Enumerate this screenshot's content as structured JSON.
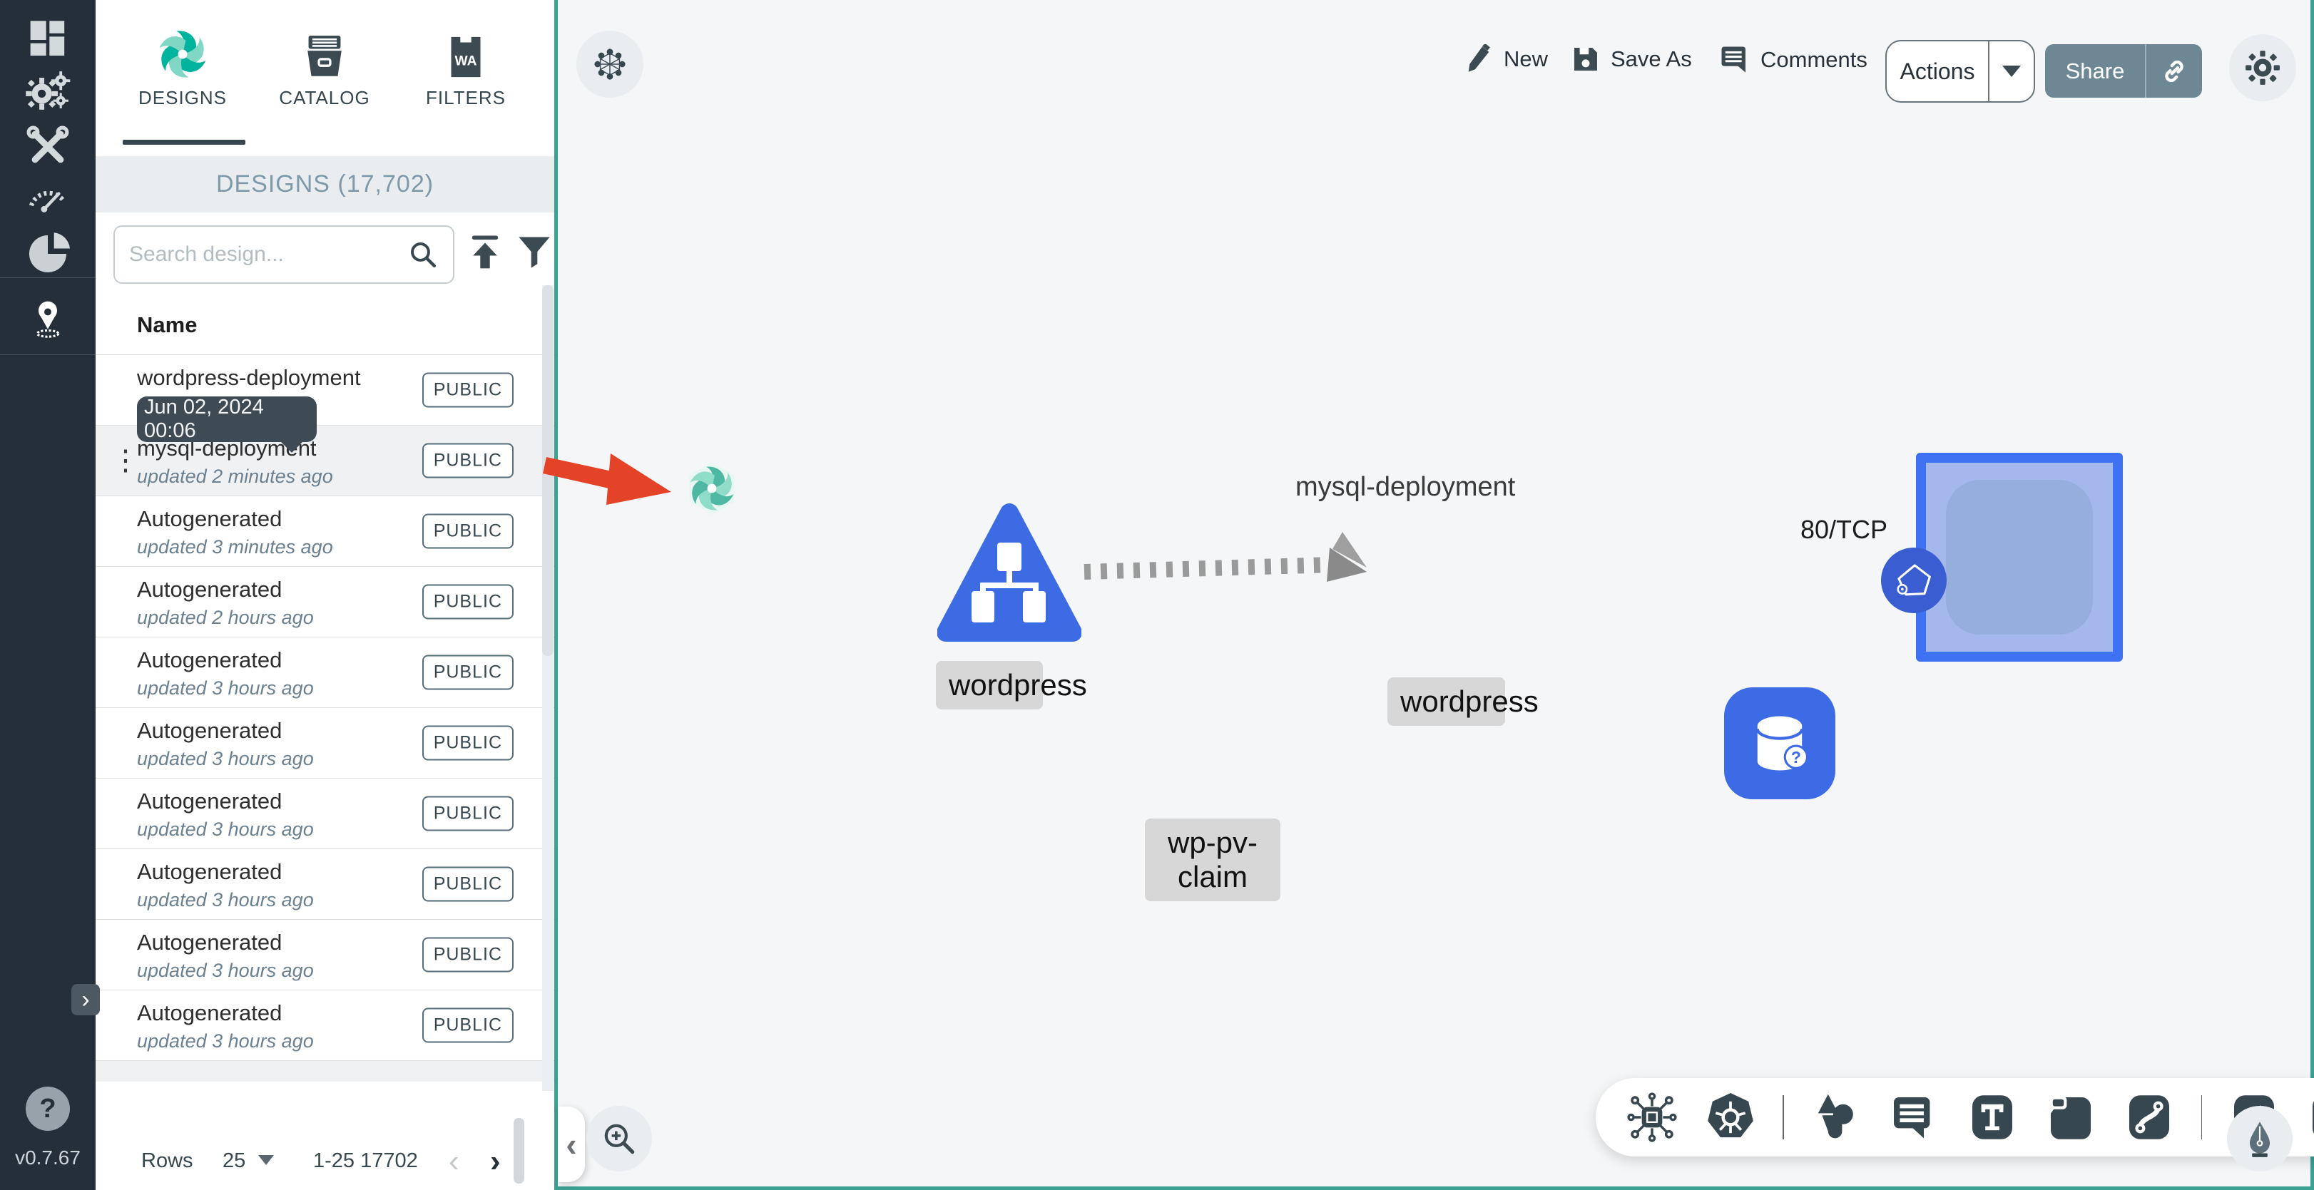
{
  "app": {
    "version": "v0.7.67",
    "help_glyph": "?"
  },
  "colors": {
    "accent_teal": "#3ca092",
    "sidebar_bg": "#242f3a",
    "node_blue": "#3d6be5",
    "square_border": "#3e72f2",
    "square_fill": "#a5b8ed",
    "share_button": "#6e8794",
    "arrow_red": "#e54328",
    "label_chip": "#d7d7d7",
    "tooltip_bg": "#3e4a54"
  },
  "sidebar": {
    "icons": [
      "dashboard-icon",
      "lifecycle-gears-icon",
      "configuration-tools-icon",
      "performance-speedometer-icon",
      "extensions-pie-icon",
      "kanvas-pin-icon"
    ],
    "expand_glyph": "›"
  },
  "panel": {
    "tabs": [
      {
        "label": "DESIGNS",
        "active": true
      },
      {
        "label": "CATALOG",
        "active": false
      },
      {
        "label": "FILTERS",
        "active": false
      }
    ],
    "filters_icon_text": "WA",
    "header": "DESIGNS (17,702)",
    "search_placeholder": "Search design...",
    "column_name": "Name",
    "tooltip": "Jun 02, 2024 00:06",
    "rows": [
      {
        "name": "wordpress-deployment",
        "updated": "",
        "badge": "PUBLIC",
        "highlighted": false
      },
      {
        "name": "mysql-deployment",
        "updated": "updated 2 minutes ago",
        "badge": "PUBLIC",
        "highlighted": true
      },
      {
        "name": "Autogenerated",
        "updated": "updated 3 minutes ago",
        "badge": "PUBLIC",
        "highlighted": false
      },
      {
        "name": "Autogenerated",
        "updated": "updated 2 hours ago",
        "badge": "PUBLIC",
        "highlighted": false
      },
      {
        "name": "Autogenerated",
        "updated": "updated 3 hours ago",
        "badge": "PUBLIC",
        "highlighted": false
      },
      {
        "name": "Autogenerated",
        "updated": "updated 3 hours ago",
        "badge": "PUBLIC",
        "highlighted": false
      },
      {
        "name": "Autogenerated",
        "updated": "updated 3 hours ago",
        "badge": "PUBLIC",
        "highlighted": false
      },
      {
        "name": "Autogenerated",
        "updated": "updated 3 hours ago",
        "badge": "PUBLIC",
        "highlighted": false
      },
      {
        "name": "Autogenerated",
        "updated": "updated 3 hours ago",
        "badge": "PUBLIC",
        "highlighted": false
      },
      {
        "name": "Autogenerated",
        "updated": "updated 3 hours ago",
        "badge": "PUBLIC",
        "highlighted": false
      }
    ],
    "pagination": {
      "rows_label": "Rows",
      "per_page": "25",
      "range": "1-25 17702",
      "prev_glyph": "‹",
      "next_glyph": "›"
    }
  },
  "canvas": {
    "topbar": {
      "new": "New",
      "save_as": "Save As",
      "comments": "Comments",
      "actions": "Actions",
      "share": "Share"
    },
    "edge_label": "80/TCP",
    "nodes": {
      "mysql_label": "mysql-deployment",
      "service_label": "wordpress",
      "deployment_label": "wordpress",
      "pvc_label": "wp-pv-claim"
    },
    "bottom_toolbar_icons": [
      "component-icon",
      "kubernetes-icon",
      "shapes-icon",
      "annotation-icon",
      "text-tool-icon",
      "rectangle-tool-icon",
      "link-curve-icon",
      "pen-tool-icon",
      "pencil-doodle-icon"
    ],
    "corner_buttons": [
      "mesh-toggle-icon",
      "settings-gear-icon",
      "zoom-in-icon",
      "pen-nib-icon"
    ],
    "collapse_glyph": "‹"
  }
}
